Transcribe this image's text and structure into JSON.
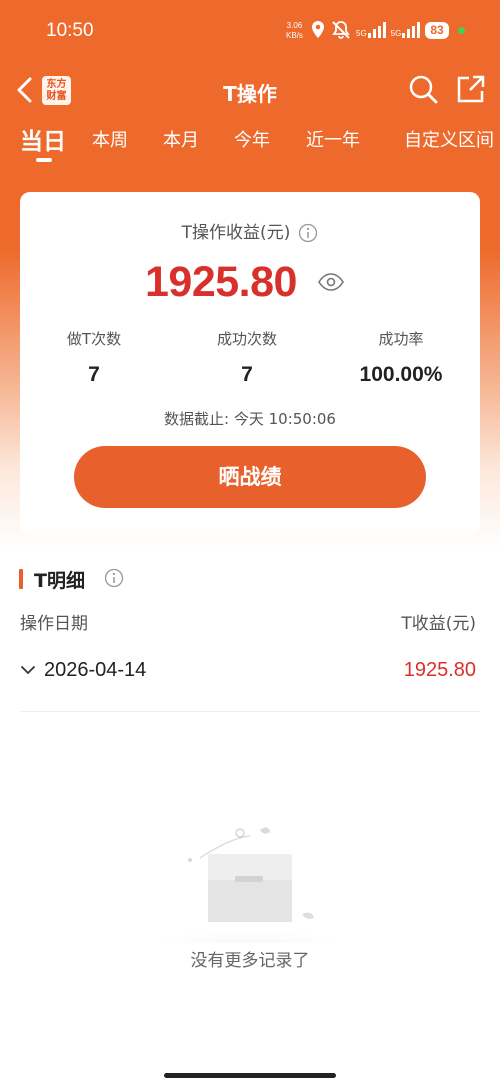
{
  "status_bar": {
    "time": "10:50",
    "net_speed_value": "3.06",
    "net_speed_unit": "KB/s",
    "signal1_label": "5G",
    "signal2_label": "5G",
    "battery": "83"
  },
  "nav": {
    "logo_line1": "东方",
    "logo_line2": "财富",
    "title": "T操作"
  },
  "tabs": [
    {
      "label": "当日",
      "active": true
    },
    {
      "label": "本周",
      "active": false
    },
    {
      "label": "本月",
      "active": false
    },
    {
      "label": "今年",
      "active": false
    },
    {
      "label": "近一年",
      "active": false
    },
    {
      "label": "自定义区间",
      "active": false
    }
  ],
  "summary": {
    "title": "T操作收益(元)",
    "amount": "1925.80",
    "stats": [
      {
        "label": "做T次数",
        "value": "7"
      },
      {
        "label": "成功次数",
        "value": "7"
      },
      {
        "label": "成功率",
        "value": "100.00%"
      }
    ],
    "data_time": "数据截止: 今天 10:50:06",
    "share_button": "晒战绩"
  },
  "details": {
    "title": "T明细",
    "col_date": "操作日期",
    "col_profit": "T收益(元)",
    "rows": [
      {
        "date": "2026-04-14",
        "profit": "1925.80"
      }
    ]
  },
  "empty": {
    "text": "没有更多记录了"
  },
  "colors": {
    "brand": "#ee6a2c",
    "profit_red": "#d8312c",
    "button": "#e8612c"
  }
}
